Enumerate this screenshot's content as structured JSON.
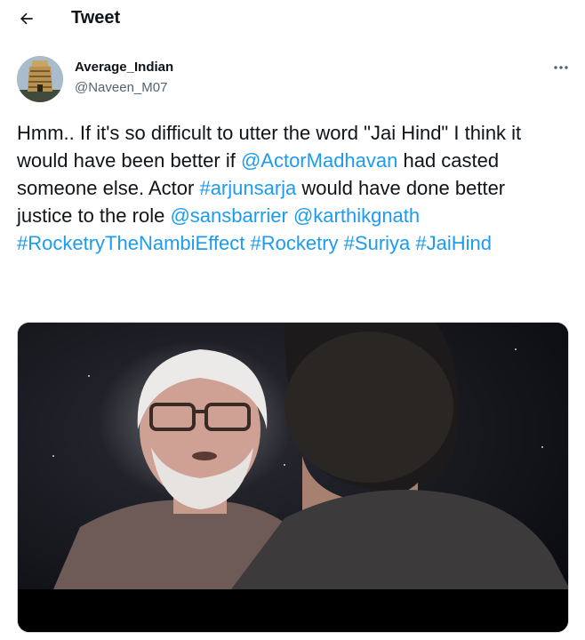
{
  "header": {
    "title": "Tweet",
    "back_icon": "arrow-left-icon"
  },
  "author": {
    "display_name": "Average_Indian",
    "username": "@Naveen_M07"
  },
  "more_icon": "more-horizontal-icon",
  "tweet": {
    "segments": [
      {
        "text": "Hmm.. If it's so difficult to utter the word \"Jai Hind\" I think it would have been better if ",
        "link": false
      },
      {
        "text": "@ActorMadhavan",
        "link": true
      },
      {
        "text": " had casted someone else. Actor ",
        "link": false
      },
      {
        "text": "#arjunsarja",
        "link": true
      },
      {
        "text": " would have done better justice to the role ",
        "link": false
      },
      {
        "text": "@sansbarrier",
        "link": true
      },
      {
        "text": " ",
        "link": false
      },
      {
        "text": "@karthikgnath",
        "link": true
      },
      {
        "text": " ",
        "link": false
      },
      {
        "text": "#RocketryTheNambiEffect",
        "link": true
      },
      {
        "text": " ",
        "link": false
      },
      {
        "text": "#Rocketry",
        "link": true
      },
      {
        "text": " ",
        "link": false
      },
      {
        "text": "#Suriya",
        "link": true
      },
      {
        "text": " ",
        "link": false
      },
      {
        "text": "#JaiHind",
        "link": true
      }
    ]
  },
  "colors": {
    "link": "#1d9bf0",
    "text": "#0f1419",
    "secondary": "#536471"
  }
}
